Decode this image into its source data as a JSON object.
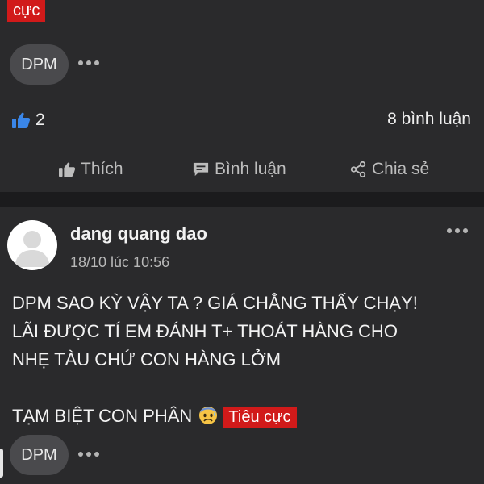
{
  "post1": {
    "sentiment_label": "cực",
    "ticker": "DPM",
    "like_count": "2",
    "comment_count": "8 bình luận",
    "actions": {
      "like": "Thích",
      "comment": "Bình luận",
      "share": "Chia sẻ"
    }
  },
  "post2": {
    "author": "dang quang dao",
    "timestamp": "18/10 lúc 10:56",
    "body_lines": [
      "DPM SAO KỲ VẬY TA ? GIÁ CHẲNG THẤY CHẠY!",
      "LÃI ĐƯỢC TÍ EM ĐÁNH T+ THOÁT HÀNG CHO",
      "NHẸ TÀU CHỨ CON HÀNG LỞM",
      "TẠM BIỆT CON PHÂN"
    ],
    "sentiment_label": "Tiêu cực",
    "ticker": "DPM"
  },
  "colors": {
    "background": "#1b1b1d",
    "card": "#2a2a2c",
    "negative_badge": "#d11a1a",
    "like_icon": "#3a86e8",
    "pill": "#4a4a4d"
  },
  "icons": {
    "like": "thumbs-up-icon",
    "comment": "comment-bubble-icon",
    "share": "share-icon",
    "more": "more-horizontal-icon",
    "emoji": "anxious-sweat-emoji-icon",
    "avatar": "default-avatar-icon"
  }
}
